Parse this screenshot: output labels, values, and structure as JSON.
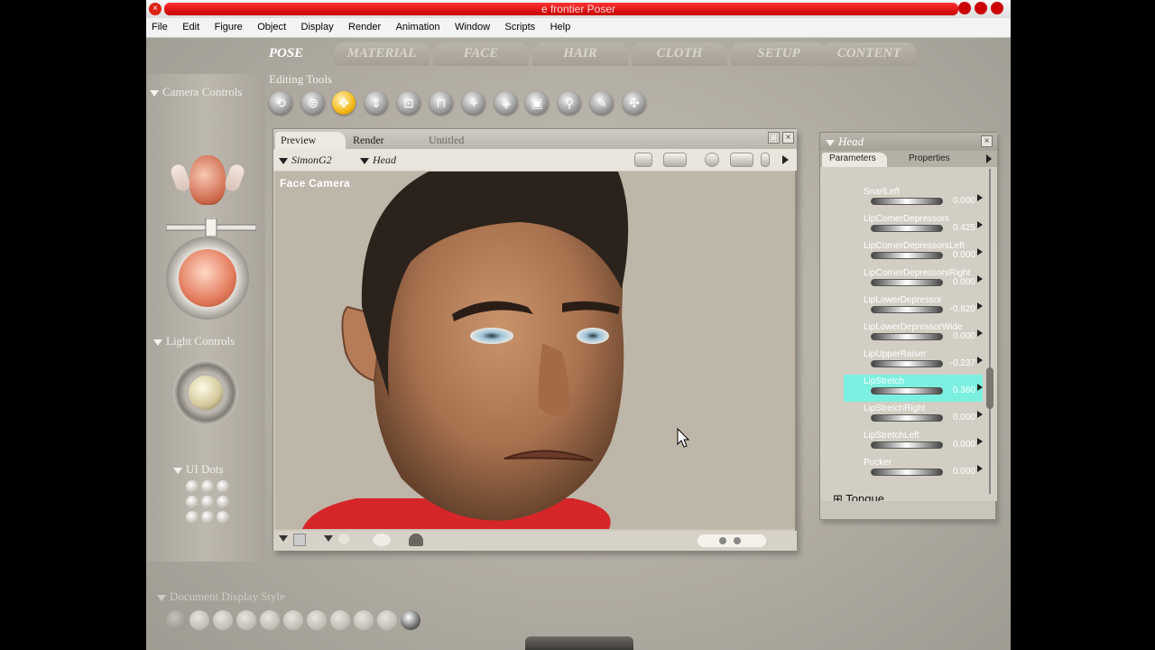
{
  "window": {
    "title": "e frontier Poser"
  },
  "menu": [
    "File",
    "Edit",
    "Figure",
    "Object",
    "Display",
    "Render",
    "Animation",
    "Window",
    "Scripts",
    "Help"
  ],
  "rooms": [
    {
      "label": "POSE",
      "active": true
    },
    {
      "label": "MATERIAL"
    },
    {
      "label": "FACE"
    },
    {
      "label": "HAIR"
    },
    {
      "label": "CLOTH"
    },
    {
      "label": "SETUP"
    },
    {
      "label": "CONTENT"
    }
  ],
  "sections": {
    "editing_tools": "Editing Tools",
    "camera_controls": "Camera Controls",
    "light_controls": "Light Controls",
    "ui_dots": "UI Dots",
    "document_display_style": "Document Display Style"
  },
  "preview": {
    "tabs": [
      "Preview",
      "Render",
      "Untitled"
    ],
    "figure_select": "SimonG2",
    "actor_select": "Head",
    "camera_label": "Face Camera"
  },
  "params_panel": {
    "title": "Head",
    "tabs": [
      "Parameters",
      "Properties"
    ],
    "rows": [
      {
        "name": "SnarlLeft",
        "value": "0.000"
      },
      {
        "name": "LipCornerDepressors",
        "value": "0.425"
      },
      {
        "name": "LipCornerDepressorsLeft",
        "value": "0.000"
      },
      {
        "name": "LipCornerDepressorsRight",
        "value": "0.000"
      },
      {
        "name": "LipLowerDepressor",
        "value": "-0.820"
      },
      {
        "name": "LipLowerDepressorWide",
        "value": "0.000"
      },
      {
        "name": "LipUpperRaiser",
        "value": "-0.237"
      },
      {
        "name": "LipStretch",
        "value": "0.360",
        "highlight": true
      },
      {
        "name": "LipStretchRight",
        "value": "0.000"
      },
      {
        "name": "LipStretchLeft",
        "value": "0.000"
      },
      {
        "name": "Pucker",
        "value": "0.000"
      }
    ],
    "group": "Tongue",
    "highlight_color": "#7cf0e0"
  },
  "colors": {
    "title_red": "#d10000",
    "active_tool": "#f5b816"
  }
}
